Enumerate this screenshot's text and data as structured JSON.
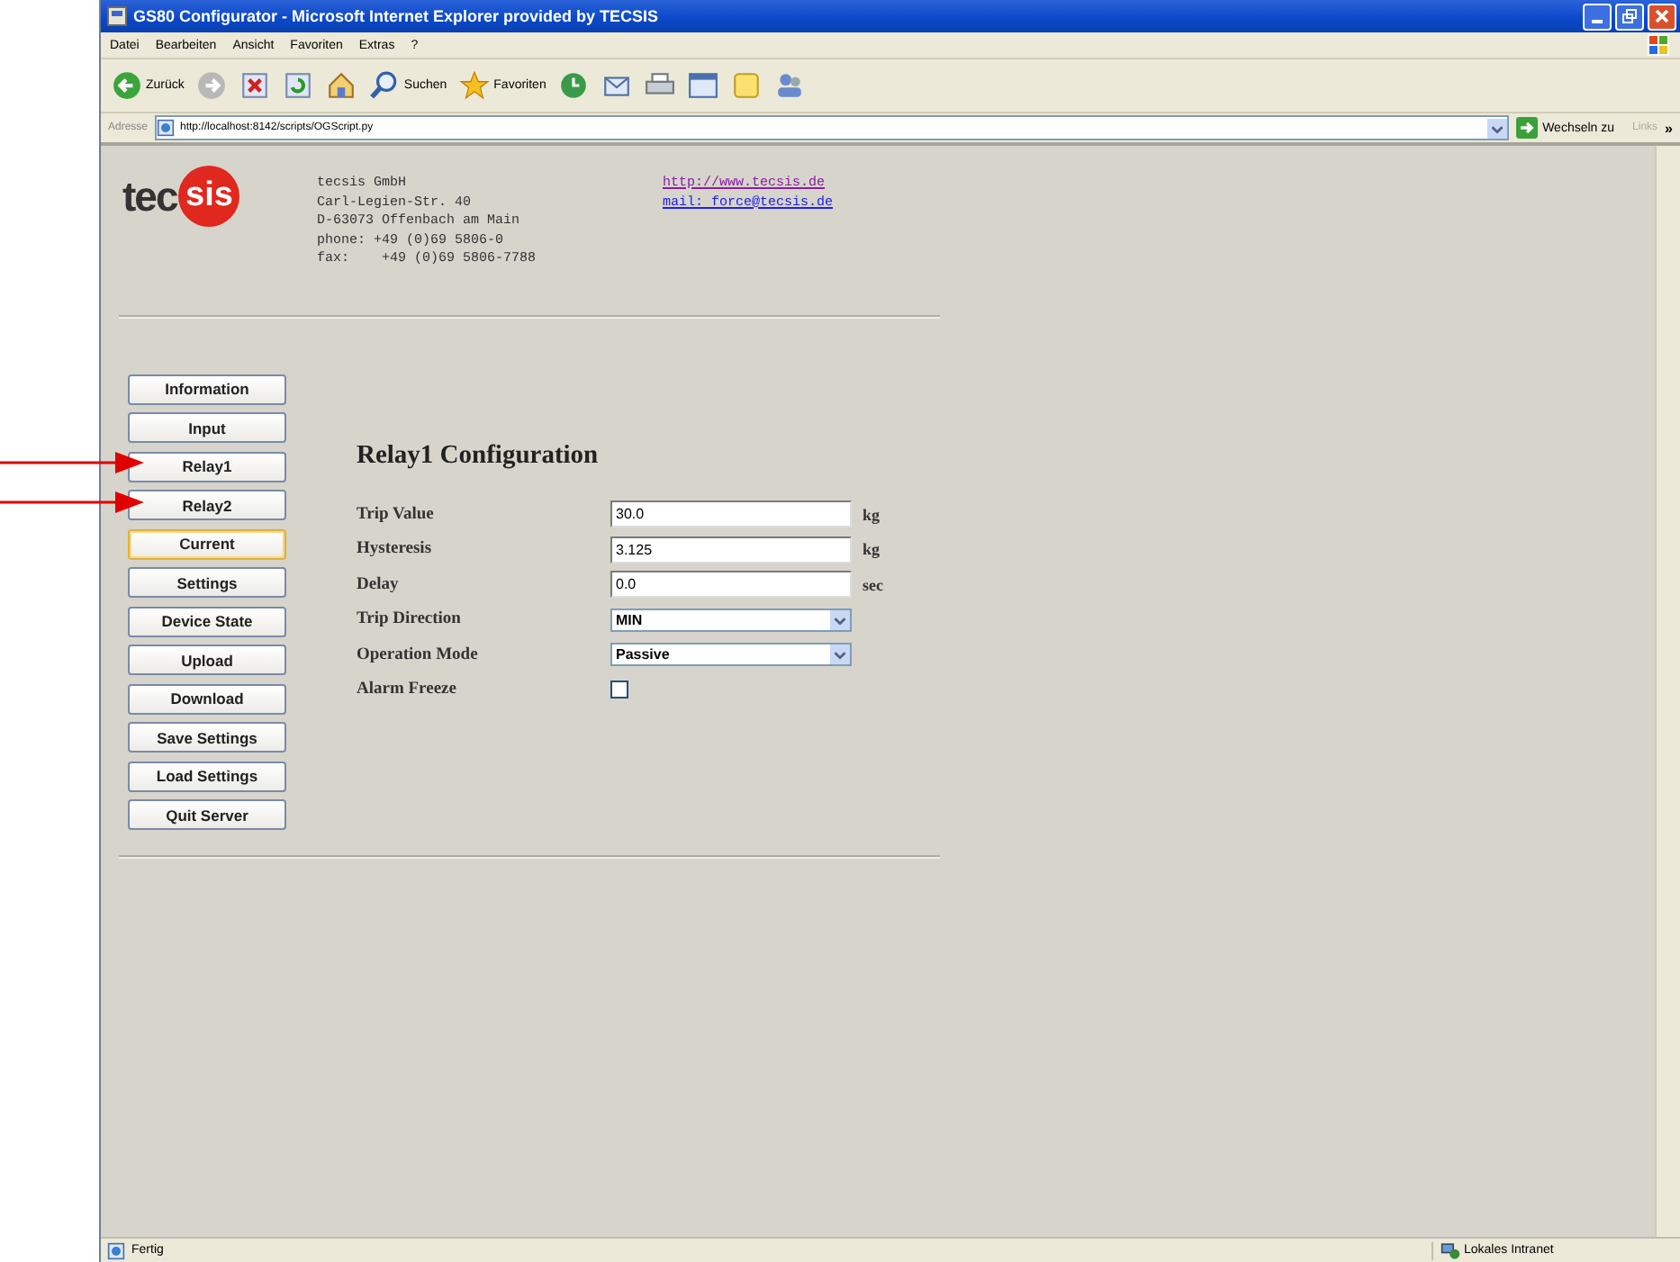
{
  "window": {
    "title": "GS80 Configurator - Microsoft Internet Explorer provided by TECSIS"
  },
  "menu": [
    "Datei",
    "Bearbeiten",
    "Ansicht",
    "Favoriten",
    "Extras",
    "?"
  ],
  "toolbar": [
    {
      "kind": "back",
      "label": "Zurück"
    },
    {
      "kind": "forward"
    },
    {
      "kind": "stop"
    },
    {
      "kind": "refresh"
    },
    {
      "kind": "home"
    },
    {
      "kind": "search",
      "label": "Suchen"
    },
    {
      "kind": "favorites",
      "label": "Favoriten"
    },
    {
      "kind": "history"
    },
    {
      "kind": "mail"
    },
    {
      "kind": "print"
    },
    {
      "kind": "edit"
    },
    {
      "kind": "note"
    },
    {
      "kind": "messenger"
    }
  ],
  "address_bar": {
    "label": "Adresse",
    "value": "http://localhost:8142/scripts/OGScript.py",
    "go": "Wechseln zu",
    "links": "Links",
    "more": "»"
  },
  "header": {
    "logo_left": "tec",
    "logo_right": "sis",
    "address_lines": [
      "tecsis GmbH",
      "Carl-Legien-Str. 40",
      "D-63073 Offenbach am Main",
      "phone: +49 (0)69 5806-0",
      "fax:    +49 (0)69 5806-7788"
    ],
    "links": [
      {
        "text": "http://www.tecsis.de",
        "visited": true
      },
      {
        "text": "mail: force@tecsis.de",
        "visited": false
      }
    ]
  },
  "nav_buttons": [
    {
      "label": "Information",
      "highlighted": false,
      "arrow": false
    },
    {
      "label": "Input",
      "highlighted": false,
      "arrow": false
    },
    {
      "label": "Relay1",
      "highlighted": false,
      "arrow": true
    },
    {
      "label": "Relay2",
      "highlighted": false,
      "arrow": true
    },
    {
      "label": "Current",
      "highlighted": true,
      "arrow": false
    },
    {
      "label": "Settings",
      "highlighted": false,
      "arrow": false
    },
    {
      "label": "Device State",
      "highlighted": false,
      "arrow": false
    },
    {
      "label": "Upload",
      "highlighted": false,
      "arrow": false
    },
    {
      "label": "Download",
      "highlighted": false,
      "arrow": false
    },
    {
      "label": "Save Settings",
      "highlighted": false,
      "arrow": false
    },
    {
      "label": "Load Settings",
      "highlighted": false,
      "arrow": false
    },
    {
      "label": "Quit Server",
      "highlighted": false,
      "arrow": false
    }
  ],
  "form": {
    "heading": "Relay1 Configuration",
    "fields": [
      {
        "kind": "text",
        "label": "Trip Value",
        "value": "30.0",
        "unit": "kg"
      },
      {
        "kind": "text",
        "label": "Hysteresis",
        "value": "3.125",
        "unit": "kg"
      },
      {
        "kind": "text",
        "label": "Delay",
        "value": "0.0",
        "unit": "sec"
      },
      {
        "kind": "select",
        "label": "Trip Direction",
        "value": "MIN"
      },
      {
        "kind": "select",
        "label": "Operation Mode",
        "value": "Passive"
      },
      {
        "kind": "checkbox",
        "label": "Alarm Freeze",
        "checked": false
      }
    ]
  },
  "status_bar": {
    "status": "Fertig",
    "zone": "Lokales Intranet"
  }
}
